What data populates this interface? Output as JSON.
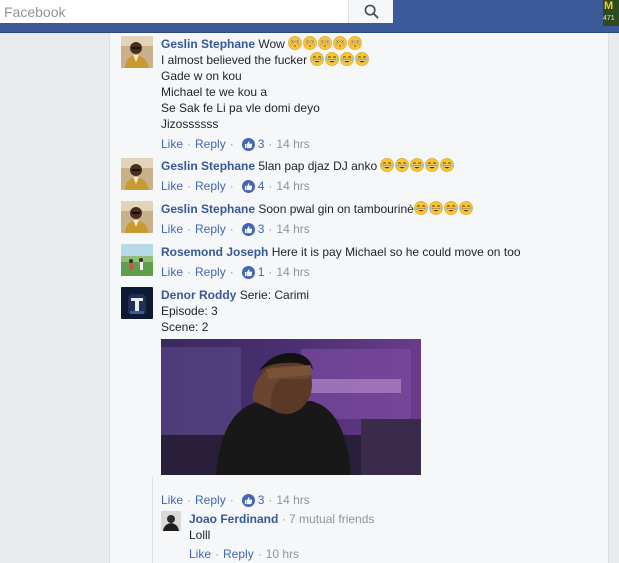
{
  "search": {
    "placeholder": "Facebook"
  },
  "corner": {
    "top": "M",
    "bottom": "471"
  },
  "comments": [
    {
      "author": "Geslin Stephane",
      "lines": [
        "Wow",
        "I almost believed the fucker",
        "Gade w on kou",
        "Michael te we kou a",
        "Se Sak fe Li pa vle domi deyo",
        "Jizossssss"
      ],
      "like": "Like",
      "reply": "Reply",
      "likes": "3",
      "time": "14 hrs"
    },
    {
      "author": "Geslin Stephane",
      "lines": [
        "5lan pap djaz DJ anko"
      ],
      "like": "Like",
      "reply": "Reply",
      "likes": "4",
      "time": "14 hrs"
    },
    {
      "author": "Geslin Stephane",
      "lines": [
        "Soon pwal gin on tambourinè"
      ],
      "like": "Like",
      "reply": "Reply",
      "likes": "3",
      "time": "14 hrs"
    },
    {
      "author": "Rosemond Joseph",
      "lines": [
        "Here it is pay Michael so he could move on too"
      ],
      "like": "Like",
      "reply": "Reply",
      "likes": "1",
      "time": "14 hrs"
    },
    {
      "author": "Denor Roddy",
      "lines": [
        "Serie: Carimi",
        "Episode: 3",
        "Scene: 2"
      ],
      "like": "Like",
      "reply": "Reply",
      "likes": "3",
      "time": "14 hrs"
    }
  ],
  "reply": {
    "author": "Joao Ferdinand",
    "mutual": "7 mutual friends",
    "text": "Lolll",
    "like": "Like",
    "reply": "Reply",
    "time": "10 hrs"
  },
  "icons": {
    "search": "search-icon",
    "like": "thumbs-up-icon",
    "emoji_flushed": "flushed-face-icon",
    "emoji_laugh": "tears-of-joy-icon"
  },
  "colors": {
    "brand": "#3b5998",
    "link": "#365899",
    "meta": "#90949c",
    "like_blue": "#4267b2"
  }
}
